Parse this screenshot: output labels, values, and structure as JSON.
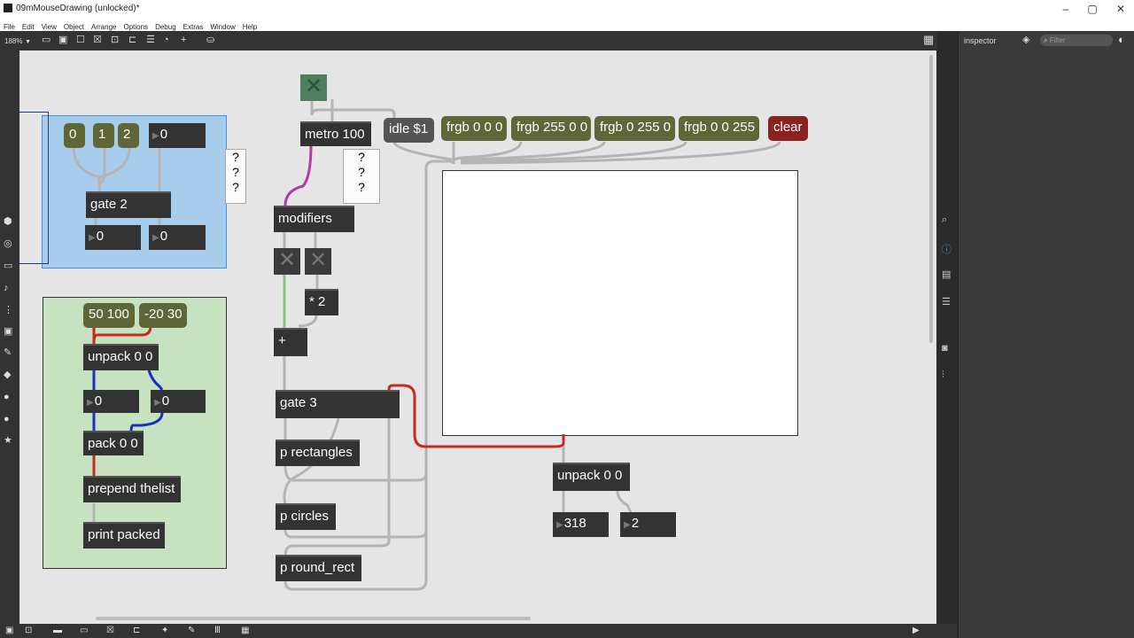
{
  "window": {
    "title": "09mMouseDrawing (unlocked)*"
  },
  "menu": [
    "File",
    "Edit",
    "View",
    "Object",
    "Arrange",
    "Options",
    "Debug",
    "Extras",
    "Window",
    "Help"
  ],
  "toolbar": {
    "zoom": "188%"
  },
  "inspector": {
    "title": "inspector",
    "filter_placeholder": "Filter"
  },
  "objects": {
    "metro": "metro 100",
    "idle": "idle $1",
    "frgb1": "frgb 0 0 0",
    "frgb2": "frgb 255 0 0",
    "frgb3": "frgb 0 255 0",
    "frgb4": "frgb 0 0 255",
    "clear": "clear",
    "modifiers": "modifiers",
    "mult": "* 2",
    "plus": "+",
    "gate3": "gate 3",
    "p_rectangles": "p rectangles",
    "p_circles": "p circles",
    "p_round_rect": "p round_rect",
    "unpack_main": "unpack 0 0",
    "num_x": "318",
    "num_y": "2",
    "gate2": "gate 2",
    "m0": "0",
    "m1": "1",
    "m2": "2",
    "gate_num_in": "0",
    "gate_out1": "0",
    "gate_out2": "0",
    "msg_a": "50 100",
    "msg_b": "-20 30",
    "unpack_green": "unpack 0 0",
    "gnum1": "0",
    "gnum2": "0",
    "pack": "pack 0 0",
    "prepend": "prepend thelist",
    "print": "print packed",
    "comment_q1": "?\n?\n?",
    "comment_q2": "?\n?\n?"
  },
  "colors": {
    "canvas": "#e5e5e5",
    "object": "#333333",
    "message": "#5f6637",
    "clear_message": "#8b2222",
    "blue_panel": "#a8ccec",
    "green_panel": "#c7e2c0"
  }
}
